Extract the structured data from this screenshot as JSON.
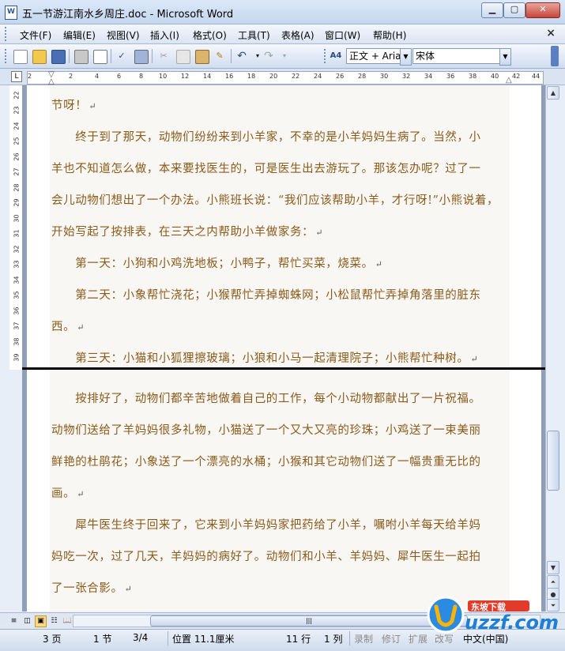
{
  "window": {
    "title": "五一节游江南水乡周庄.doc - Microsoft Word",
    "doc_icon": "W",
    "controls": [
      "minimize-icon",
      "maximize-icon",
      "close-icon"
    ]
  },
  "menu": {
    "items": [
      "文件(F)",
      "编辑(E)",
      "视图(V)",
      "插入(I)",
      "格式(O)",
      "工具(T)",
      "表格(A)",
      "窗口(W)",
      "帮助(H)"
    ],
    "close_doc": "×"
  },
  "toolbar": {
    "style_value": "正文 + Aria",
    "font_value": "宋体",
    "style_icon_label": "A4"
  },
  "ruler": {
    "numbers": [
      "2",
      "2",
      "4",
      "6",
      "8",
      "10",
      "12",
      "14",
      "16",
      "18",
      "20",
      "22",
      "24",
      "26",
      "28",
      "30",
      "32",
      "34",
      "36",
      "38",
      "40",
      "42",
      "44"
    ],
    "corner": "L"
  },
  "vruler": {
    "numbers": [
      "22",
      "23",
      "24",
      "25",
      "26",
      "27",
      "28",
      "29",
      "30",
      "31",
      "32",
      "33",
      "34",
      "35",
      "36",
      "37",
      "38",
      "39"
    ]
  },
  "document": {
    "page1": [
      "节呀！",
      "　　终于到了那天，动物们纷纷来到小羊家，不幸的是小羊妈妈生病了。当然，小",
      "羊也不知道怎么做，本来要找医生的，可是医生出去游玩了。那该怎办呢？过了一",
      "会儿动物们想出了一个办法。小熊班长说：“我们应该帮助小羊，才行呀!”小熊说着，",
      "开始写起了按排表，在三天之内帮助小羊做家务：",
      "　　第一天：小狗和小鸡洗地板；小鸭子，帮忙买菜，烧菜。",
      "　　第二天：小象帮忙浇花；小猴帮忙弄掉蜘蛛网；小松鼠帮忙弄掉角落里的脏东",
      "西。",
      "　　第三天：小猫和小狐狸擦玻璃；小狼和小马一起清理院子；小熊帮忙种树。"
    ],
    "page2": [
      "　　按排好了，动物们都辛苦地做着自己的工作，每个小动物都献出了一片祝福。",
      "动物们送给了羊妈妈很多礼物，小猫送了一个又大又亮的珍珠；小鸡送了一束美丽",
      "鲜艳的杜鹃花；小象送了一个漂亮的水桶；小猴和其它动物们送了一幅贵重无比的",
      "画。",
      "　　犀牛医生终于回来了，它来到小羊妈妈家把药给了小羊，嘱咐小羊每天给羊妈",
      "妈吃一次，过了几天，羊妈妈的病好了。动物们和小羊、羊妈妈、犀牛医生一起拍",
      "了一张合影。"
    ],
    "para_mark": "↵"
  },
  "status": {
    "page": "3 页",
    "section": "1 节",
    "page_of": "3/4",
    "position": "位置 11.1厘米",
    "line": "11 行",
    "column": "1 列",
    "rec": "录制",
    "trk": "修订",
    "ext": "扩展",
    "ovr": "改写",
    "language": "中文(中国)"
  },
  "watermark": {
    "brand": "uzzf.com",
    "tag": "东坡下载"
  },
  "colors": {
    "text": "#8b5a1a",
    "titlebar": "#c4d6ee"
  }
}
